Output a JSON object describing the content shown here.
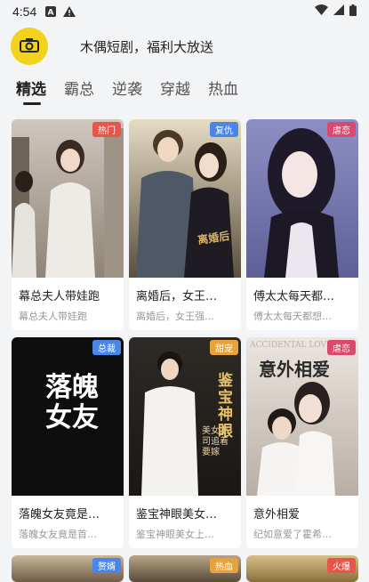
{
  "status": {
    "time": "4:54"
  },
  "header": {
    "title": "木偶短剧，福利大放送"
  },
  "tabs": [
    {
      "label": "精选"
    },
    {
      "label": "霸总"
    },
    {
      "label": "逆袭"
    },
    {
      "label": "穿越"
    },
    {
      "label": "热血"
    }
  ],
  "cards": [
    {
      "badge": "热门",
      "badge_color": "#e8564a",
      "title": "幕总夫人带娃跑",
      "sub": "幕总夫人带娃跑"
    },
    {
      "badge": "复仇",
      "badge_color": "#4a86e8",
      "title": "离婚后，女王…",
      "sub": "离婚后，女王强…"
    },
    {
      "badge": "虐恋",
      "badge_color": "#d94a6e",
      "title": "傅太太每天都…",
      "sub": "傅太太每天都想…"
    },
    {
      "badge": "总裁",
      "badge_color": "#4a86e8",
      "title": "落魄女友竟是…",
      "sub": "落魄女友竟是首…"
    },
    {
      "badge": "甜宠",
      "badge_color": "#e8a23a",
      "title": "鉴宝神眼美女…",
      "sub": "鉴宝神眼美女上…"
    },
    {
      "badge": "虐恋",
      "badge_color": "#d94a6e",
      "title": "意外相爱",
      "sub": "纪如意爱了霍希…"
    },
    {
      "badge": "赘婿",
      "badge_color": "#4a86e8"
    },
    {
      "badge": "热血",
      "badge_color": "#e8a23a"
    },
    {
      "badge": "火爆",
      "badge_color": "#e8564a"
    }
  ],
  "cover_text": {
    "c4_main": "落魄女友",
    "c5_main": "鉴宝神眼",
    "c5_side": "美女上司追着要嫁",
    "c6_main": "意外相爱",
    "c6_en": "ACCIDENTAL LOVE"
  }
}
